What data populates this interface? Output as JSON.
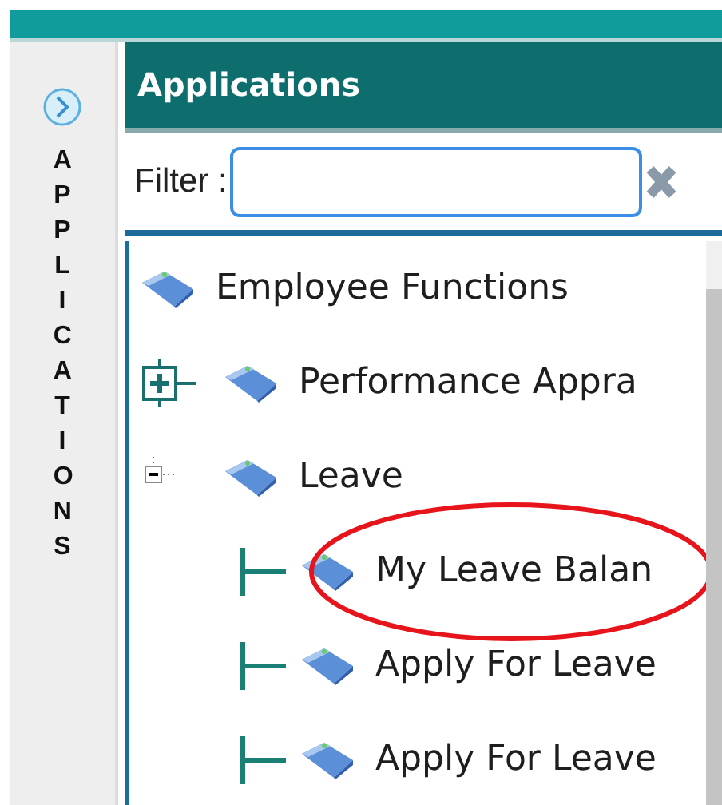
{
  "sidebar": {
    "label": "APPLICATIONS"
  },
  "panel": {
    "title": "Applications"
  },
  "filter": {
    "label": "Filter :"
  },
  "tree": [
    {
      "kind": "heading",
      "label": "Employee Functions",
      "circled": false
    },
    {
      "kind": "branch",
      "label": "Performance Appra",
      "expanded": false,
      "circled": false
    },
    {
      "kind": "branch",
      "label": "Leave",
      "expanded": true,
      "circled": false,
      "children": [
        {
          "kind": "leaf",
          "label": "My Leave Balan",
          "circled": true
        },
        {
          "kind": "leaf",
          "label": "Apply For Leave",
          "circled": false
        },
        {
          "kind": "leaf",
          "label": "Apply For Leave",
          "circled": false
        }
      ]
    }
  ]
}
